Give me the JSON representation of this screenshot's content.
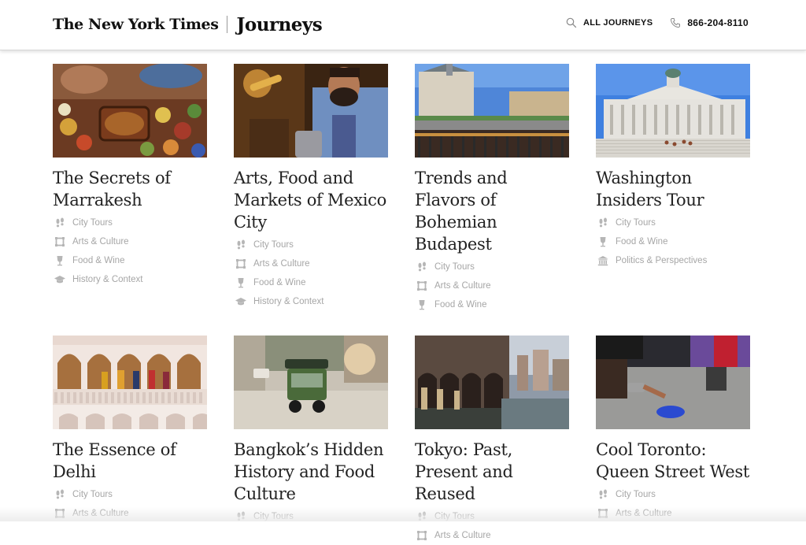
{
  "header": {
    "nyt_logo": "The New York Times",
    "journeys_logo": "Journeys",
    "nav": {
      "all_journeys": "ALL JOURNEYS",
      "phone": "866-204-8110"
    }
  },
  "tag_icons": {
    "City Tours": "footprints-icon",
    "Arts & Culture": "frame-icon",
    "Food & Wine": "wineglass-icon",
    "History & Context": "graduation-cap-icon",
    "Politics & Perspectives": "capitol-icon"
  },
  "trips": [
    {
      "title": "The Secrets of Marrakesh",
      "photo": "marrakesh-food-photo",
      "tags": [
        "City Tours",
        "Arts & Culture",
        "Food & Wine",
        "History & Context"
      ]
    },
    {
      "title": "Arts, Food and Markets of Mexico City",
      "photo": "mexico-city-bartender-photo",
      "tags": [
        "City Tours",
        "Arts & Culture",
        "Food & Wine",
        "History & Context"
      ]
    },
    {
      "title": "Trends and Flavors of Bohemian Budapest",
      "photo": "budapest-riverfront-photo",
      "tags": [
        "City Tours",
        "Arts & Culture",
        "Food & Wine"
      ]
    },
    {
      "title": "Washington Insiders Tour",
      "photo": "library-of-congress-photo",
      "tags": [
        "City Tours",
        "Food & Wine",
        "Politics & Perspectives"
      ]
    },
    {
      "title": "The Essence of Delhi",
      "photo": "delhi-balcony-photo",
      "tags": [
        "City Tours",
        "Arts & Culture"
      ]
    },
    {
      "title": "Bangkok’s Hidden History and Food Culture",
      "photo": "bangkok-tuktuk-photo",
      "tags": [
        "City Tours"
      ]
    },
    {
      "title": "Tokyo: Past, Present and Reused",
      "photo": "tokyo-canal-photo",
      "tags": [
        "City Tours",
        "Arts & Culture"
      ]
    },
    {
      "title": "Cool Toronto: Queen Street West",
      "photo": "toronto-chalk-art-photo",
      "tags": [
        "City Tours",
        "Arts & Culture"
      ]
    }
  ]
}
